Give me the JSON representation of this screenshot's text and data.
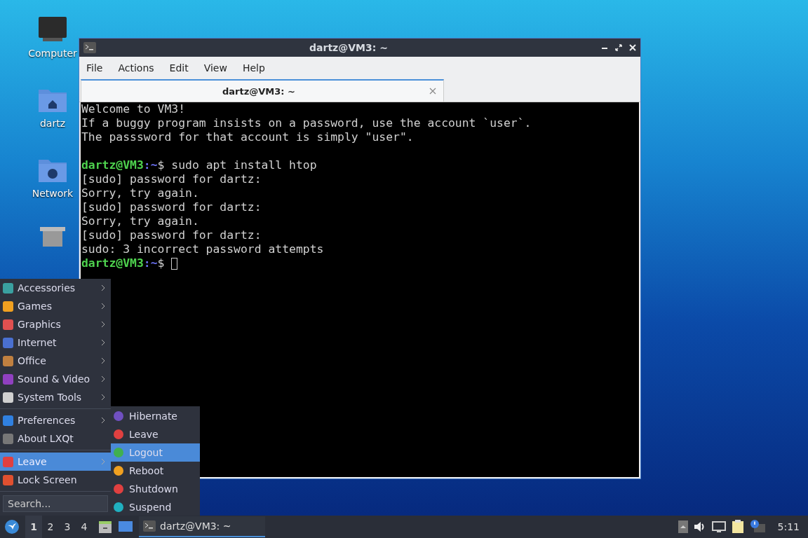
{
  "desktop_icons": [
    {
      "label": "Computer"
    },
    {
      "label": "dartz"
    },
    {
      "label": "Network"
    }
  ],
  "window": {
    "title": "dartz@VM3: ~",
    "menu": [
      "File",
      "Actions",
      "Edit",
      "View",
      "Help"
    ],
    "tabs": [
      {
        "label": "dartz@VM3: ~",
        "selected": true
      }
    ],
    "terminal": {
      "blocks": [
        [
          {
            "kind": "text",
            "text": "Welcome to VM3!"
          },
          {
            "kind": "text",
            "text": "If a buggy program insists on a password, use the account `user`."
          },
          {
            "kind": "text",
            "text": "The passsword for that account is simply \"user\"."
          }
        ],
        [
          {
            "kind": "prompt",
            "user": "dartz@VM3",
            "path": ":~",
            "command": "$ sudo apt install htop",
            "cursor": false
          },
          {
            "kind": "text",
            "text": "[sudo] password for dartz:"
          },
          {
            "kind": "text",
            "text": "Sorry, try again."
          },
          {
            "kind": "text",
            "text": "[sudo] password for dartz:"
          },
          {
            "kind": "text",
            "text": "Sorry, try again."
          },
          {
            "kind": "text",
            "text": "[sudo] password for dartz:"
          },
          {
            "kind": "text",
            "text": "sudo: 3 incorrect password attempts"
          },
          {
            "kind": "prompt",
            "user": "dartz@VM3",
            "path": ":~",
            "command": "$",
            "cursor": true
          }
        ]
      ]
    }
  },
  "start_menu": {
    "groups": [
      [
        {
          "label": "Accessories",
          "submenu": true,
          "selected": false
        },
        {
          "label": "Games",
          "submenu": true,
          "selected": false
        },
        {
          "label": "Graphics",
          "submenu": true,
          "selected": false
        },
        {
          "label": "Internet",
          "submenu": true,
          "selected": false
        },
        {
          "label": "Office",
          "submenu": true,
          "selected": false
        },
        {
          "label": "Sound & Video",
          "submenu": true,
          "selected": false
        },
        {
          "label": "System Tools",
          "submenu": true,
          "selected": false
        }
      ],
      [
        {
          "label": "Preferences",
          "submenu": true,
          "selected": false
        },
        {
          "label": "About LXQt",
          "submenu": false,
          "selected": false
        }
      ],
      [
        {
          "label": "Leave",
          "submenu": true,
          "selected": true
        },
        {
          "label": "Lock Screen",
          "submenu": false,
          "selected": false
        }
      ]
    ],
    "search": {
      "placeholder": "Search..."
    }
  },
  "leave_submenu": [
    {
      "label": "Hibernate",
      "selected": false
    },
    {
      "label": "Leave",
      "selected": false
    },
    {
      "label": "Logout",
      "selected": true
    },
    {
      "label": "Reboot",
      "selected": false
    },
    {
      "label": "Shutdown",
      "selected": false
    },
    {
      "label": "Suspend",
      "selected": false
    }
  ],
  "taskbar": {
    "workspaces": [
      {
        "label": "1",
        "selected": true
      },
      {
        "label": "2",
        "selected": false
      },
      {
        "label": "3",
        "selected": false
      },
      {
        "label": "4",
        "selected": false
      }
    ],
    "tasks": [
      {
        "label": "dartz@VM3: ~",
        "selected": true
      }
    ],
    "clock": "5:11"
  }
}
